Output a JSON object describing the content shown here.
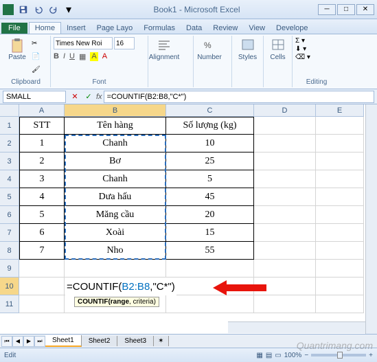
{
  "window": {
    "title": "Book1 - Microsoft Excel"
  },
  "menu": {
    "file": "File",
    "tabs": [
      "Home",
      "Insert",
      "Page Layo",
      "Formulas",
      "Data",
      "Review",
      "View",
      "Develope"
    ],
    "active": 0
  },
  "ribbon": {
    "clipboard": {
      "paste": "Paste",
      "label": "Clipboard"
    },
    "font": {
      "name": "Times New Roi",
      "size": "16",
      "label": "Font"
    },
    "alignment": {
      "label": "Alignment"
    },
    "number": {
      "label": "Number"
    },
    "styles": {
      "label": "Styles"
    },
    "cells": {
      "label": "Cells"
    },
    "editing": {
      "label": "Editing"
    }
  },
  "namebox": "SMALL",
  "formula_bar": "=COUNTIF(B2:B8,\"C*\")",
  "columns": [
    {
      "letter": "A",
      "width": 66
    },
    {
      "letter": "B",
      "width": 148
    },
    {
      "letter": "C",
      "width": 128
    },
    {
      "letter": "D",
      "width": 90
    },
    {
      "letter": "E",
      "width": 70
    }
  ],
  "rows": [
    1,
    2,
    3,
    4,
    5,
    6,
    7,
    8,
    9,
    10,
    11
  ],
  "table": {
    "header": {
      "stt": "STT",
      "ten": "Tên hàng",
      "sl": "Số lượng (kg)"
    },
    "rows": [
      {
        "stt": "1",
        "ten": "Chanh",
        "sl": "10"
      },
      {
        "stt": "2",
        "ten": "Bơ",
        "sl": "25"
      },
      {
        "stt": "3",
        "ten": "Chanh",
        "sl": "5"
      },
      {
        "stt": "4",
        "ten": "Dưa hấu",
        "sl": "45"
      },
      {
        "stt": "5",
        "ten": "Măng cầu",
        "sl": "20"
      },
      {
        "stt": "6",
        "ten": "Xoài",
        "sl": "15"
      },
      {
        "stt": "7",
        "ten": "Nho",
        "sl": "55"
      }
    ]
  },
  "formula_cell": {
    "prefix": "=COUNT",
    "mid": "IF(",
    "range": "B2:B8",
    "suffix": ",\"C*\")"
  },
  "tooltip": {
    "bold": "COUNTIF(",
    "mid": "range",
    "rest": ", criteria)"
  },
  "sheets": [
    "Sheet1",
    "Sheet2",
    "Sheet3"
  ],
  "status": {
    "mode": "Edit",
    "zoom": "100%"
  },
  "watermark": "Quantrimang.com"
}
